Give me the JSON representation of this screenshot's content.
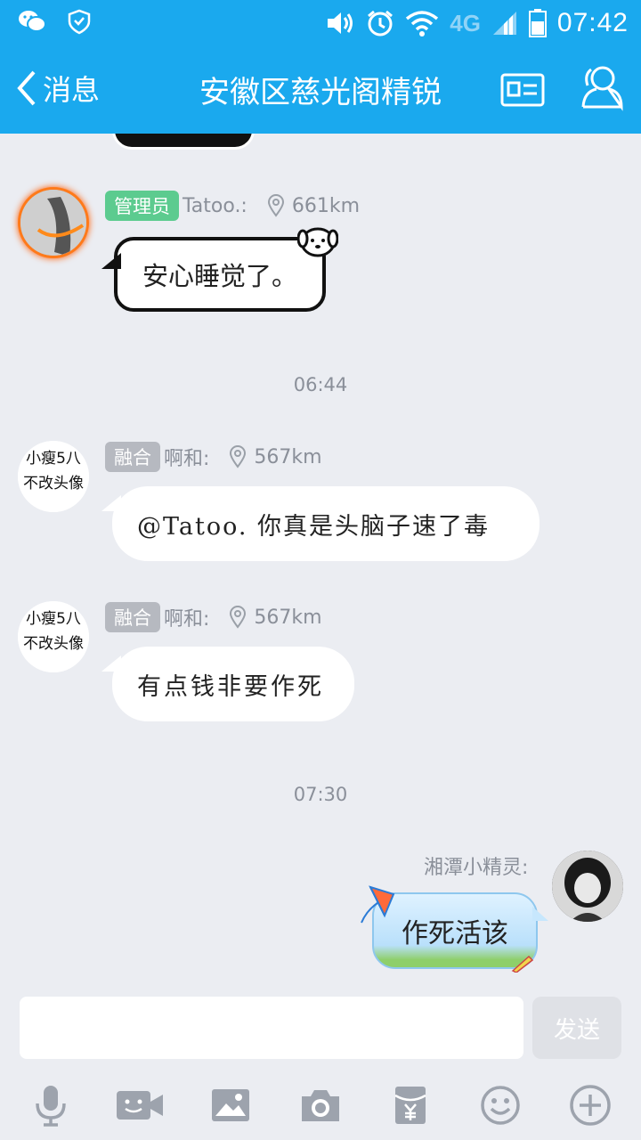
{
  "status_bar": {
    "time": "07:42",
    "network": "4G",
    "icons": [
      "wechat-icon",
      "mail-shield-icon",
      "volume-icon",
      "alarm-icon",
      "wifi-icon",
      "signal-icon",
      "battery-icon"
    ]
  },
  "header": {
    "back_label": "消息",
    "title": "安徽区慈光阁精锐",
    "icons": [
      "chevron-left-icon",
      "profile-card-icon",
      "contacts-icon"
    ]
  },
  "messages": [
    {
      "sender": "Tatoo.:",
      "badge": "管理员",
      "distance": "661km",
      "text": "安心睡觉了。",
      "style": "cartoon"
    },
    {
      "timestamp": "06:44"
    },
    {
      "sender": "啊和:",
      "badge": "融合",
      "distance": "567km",
      "avatar_text": [
        "小瘦5八",
        "不改头像"
      ],
      "text": "@Tatoo. 你真是头脑子速了毒"
    },
    {
      "sender": "啊和:",
      "badge": "融合",
      "distance": "567km",
      "avatar_text": [
        "小瘦5八",
        "不改头像"
      ],
      "text": "有点钱非要作死"
    },
    {
      "timestamp": "07:30"
    },
    {
      "sender": "湘潭小精灵:",
      "text": "作死活该",
      "mine": true
    }
  ],
  "input": {
    "placeholder": "",
    "send_label": "发送"
  },
  "toolbar": [
    "microphone-icon",
    "video-icon",
    "image-icon",
    "camera-icon",
    "red-packet-icon",
    "emoji-icon",
    "plus-icon"
  ],
  "colors": {
    "brand": "#1aa9ee",
    "background": "#ebedf2",
    "admin_badge": "#5ccb8f",
    "member_badge": "#b6b9c0"
  }
}
